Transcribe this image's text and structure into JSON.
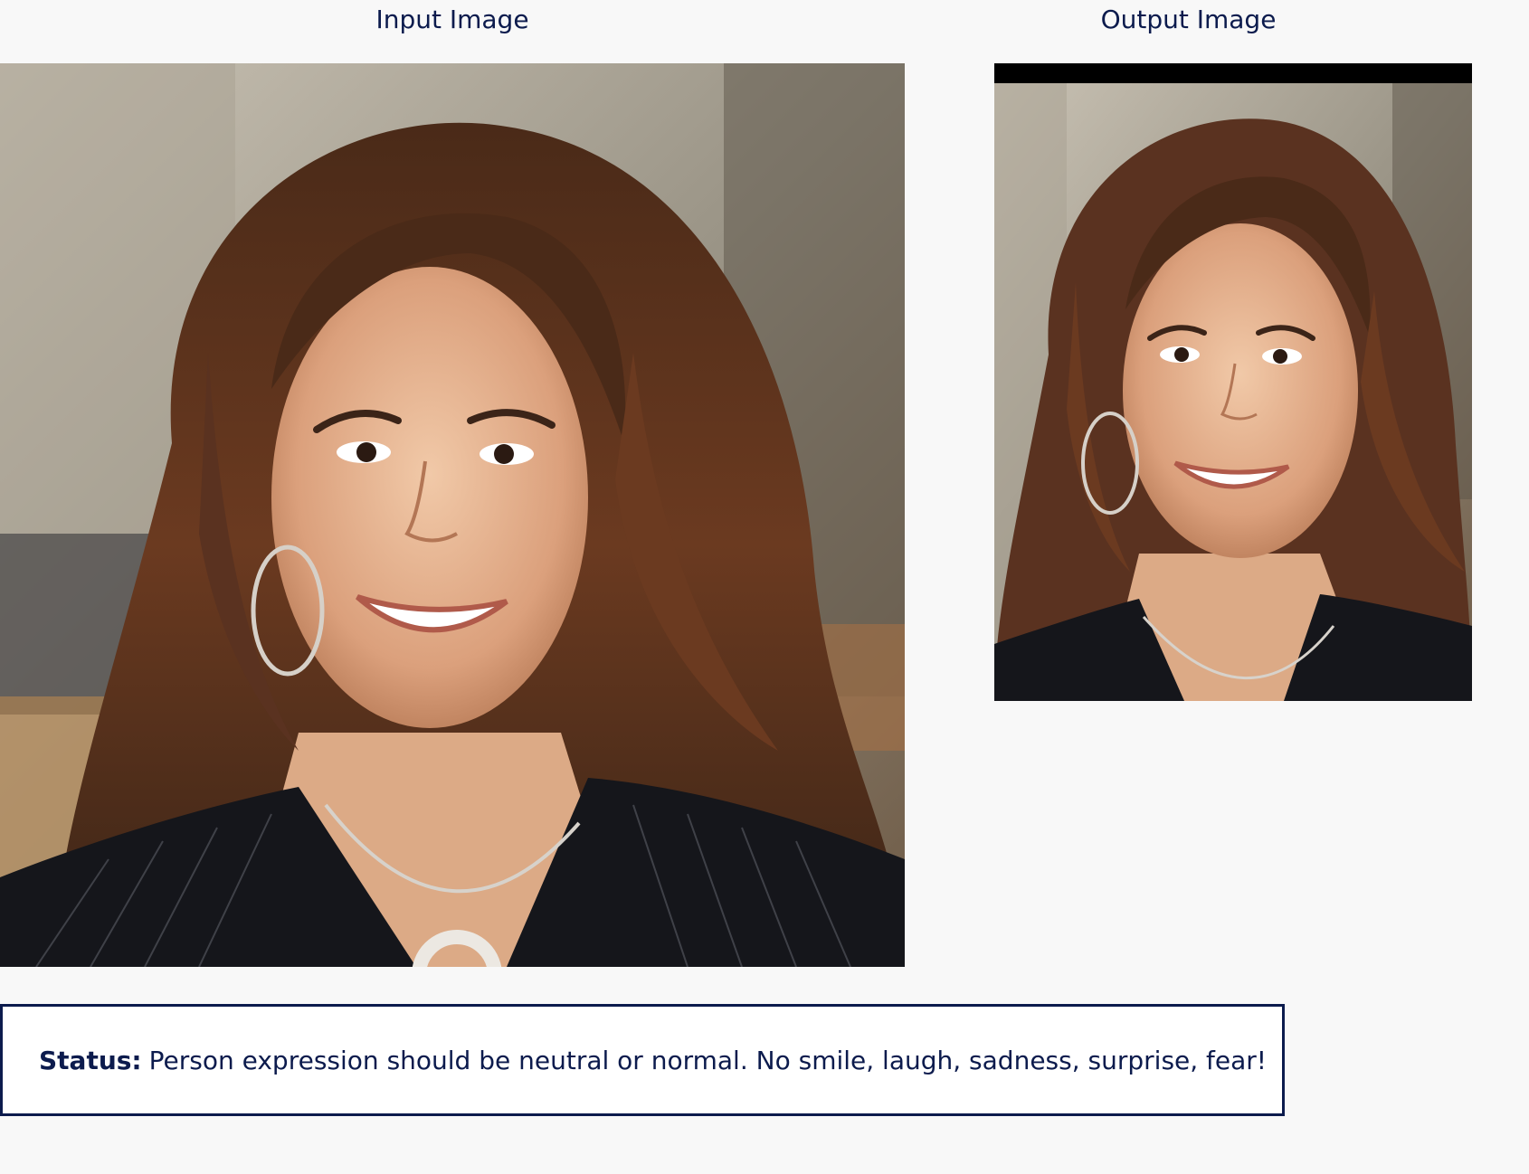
{
  "input_panel": {
    "title": "Input Image"
  },
  "output_panel": {
    "title": "Output Image"
  },
  "status": {
    "label": "Status:",
    "message": "Person expression should be neutral or normal. No smile, laugh, sadness, surprise, fear!"
  },
  "colors": {
    "text": "#0c1b4d",
    "status_border": "#0c1b4d",
    "page_background": "#f8f8f8"
  }
}
